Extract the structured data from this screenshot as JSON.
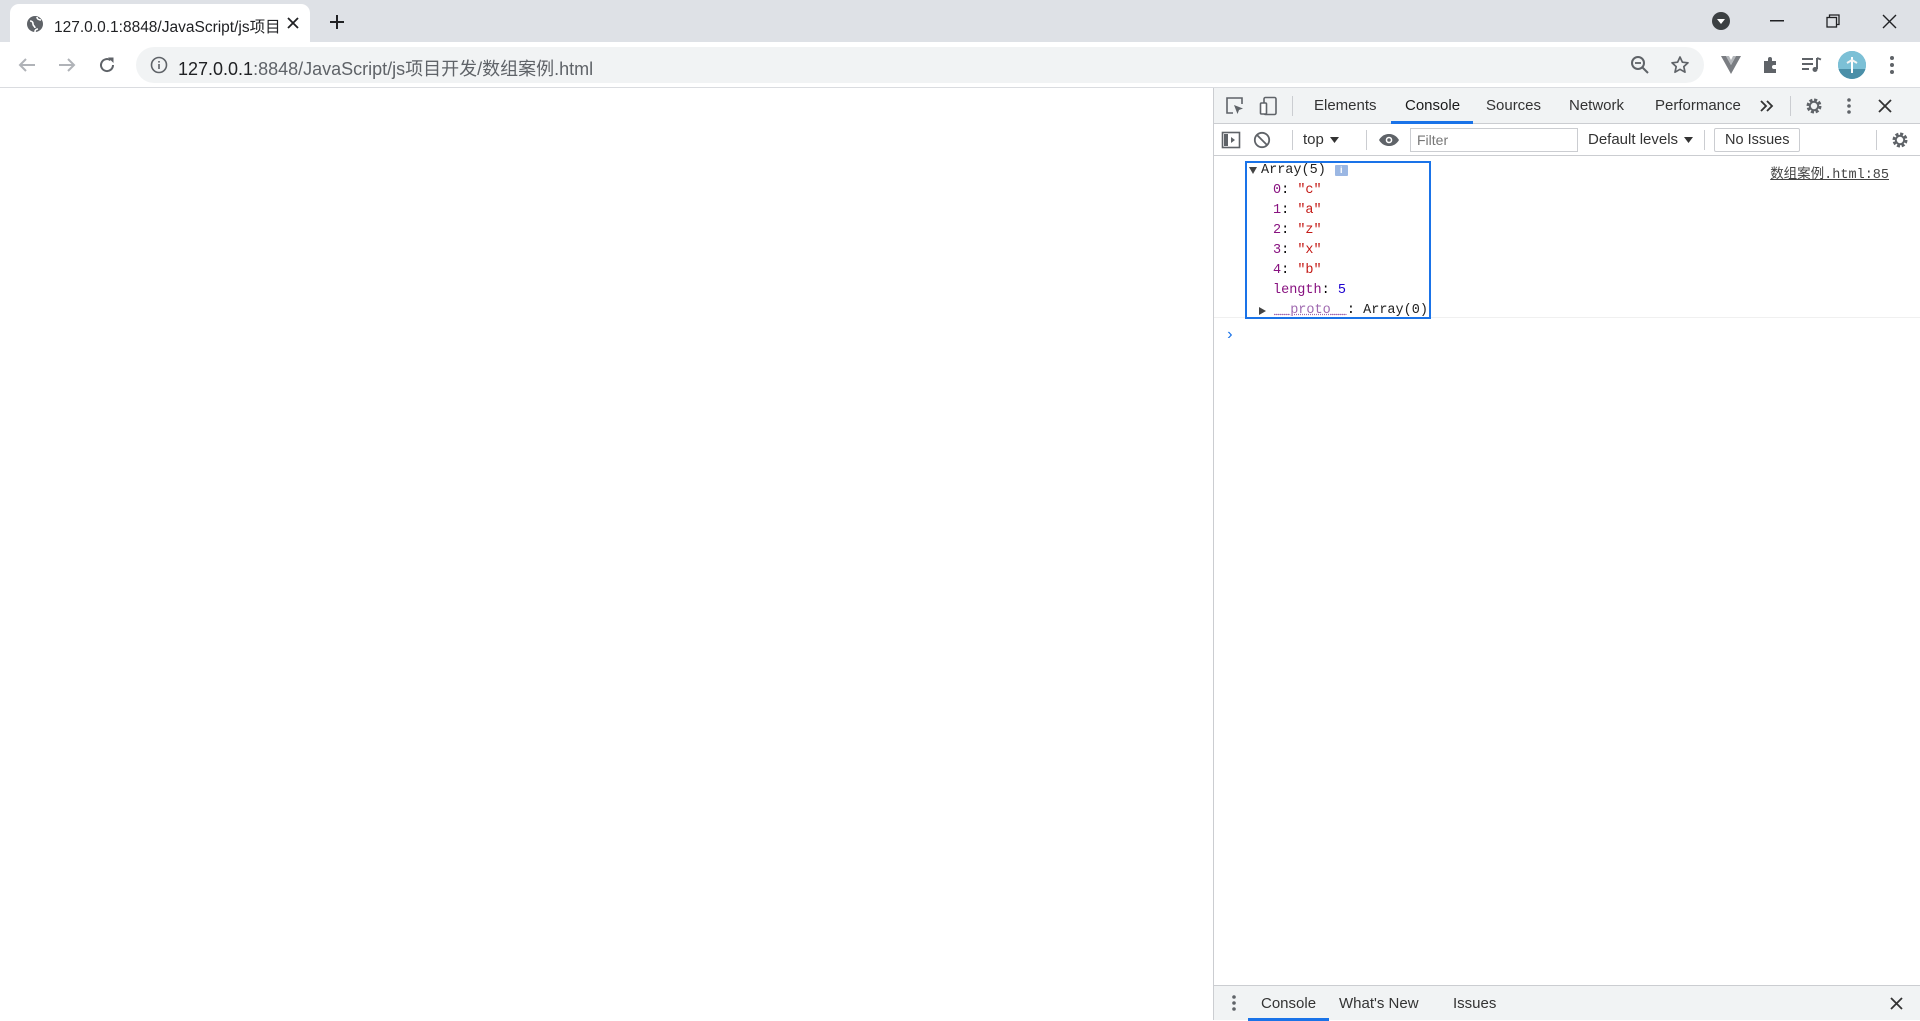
{
  "browser": {
    "tab_title": "127.0.0.1:8848/JavaScript/js项目开发/数组案例.html",
    "url_host": "127.0.0.1",
    "url_rest": ":8848/JavaScript/js项目开发/数组案例.html"
  },
  "devtools": {
    "tabs": [
      "Elements",
      "Console",
      "Sources",
      "Network",
      "Performance"
    ],
    "active_tab": "Console",
    "context": "top",
    "filter_placeholder": "Filter",
    "levels": "Default levels",
    "issues": "No Issues",
    "drawer_tabs": [
      "Console",
      "What's New",
      "Issues"
    ],
    "accent": "#1a73e8"
  },
  "console": {
    "source": "数组案例.html:85",
    "array_label": "Array(5)",
    "info_badge": "i",
    "items": [
      {
        "key": "0",
        "value": "\"c\""
      },
      {
        "key": "1",
        "value": "\"a\""
      },
      {
        "key": "2",
        "value": "\"z\""
      },
      {
        "key": "3",
        "value": "\"x\""
      },
      {
        "key": "4",
        "value": "\"b\""
      }
    ],
    "length_key": "length",
    "length_value": "5",
    "proto_key": "__proto__",
    "proto_value": "Array(0)",
    "prompt": "›"
  }
}
